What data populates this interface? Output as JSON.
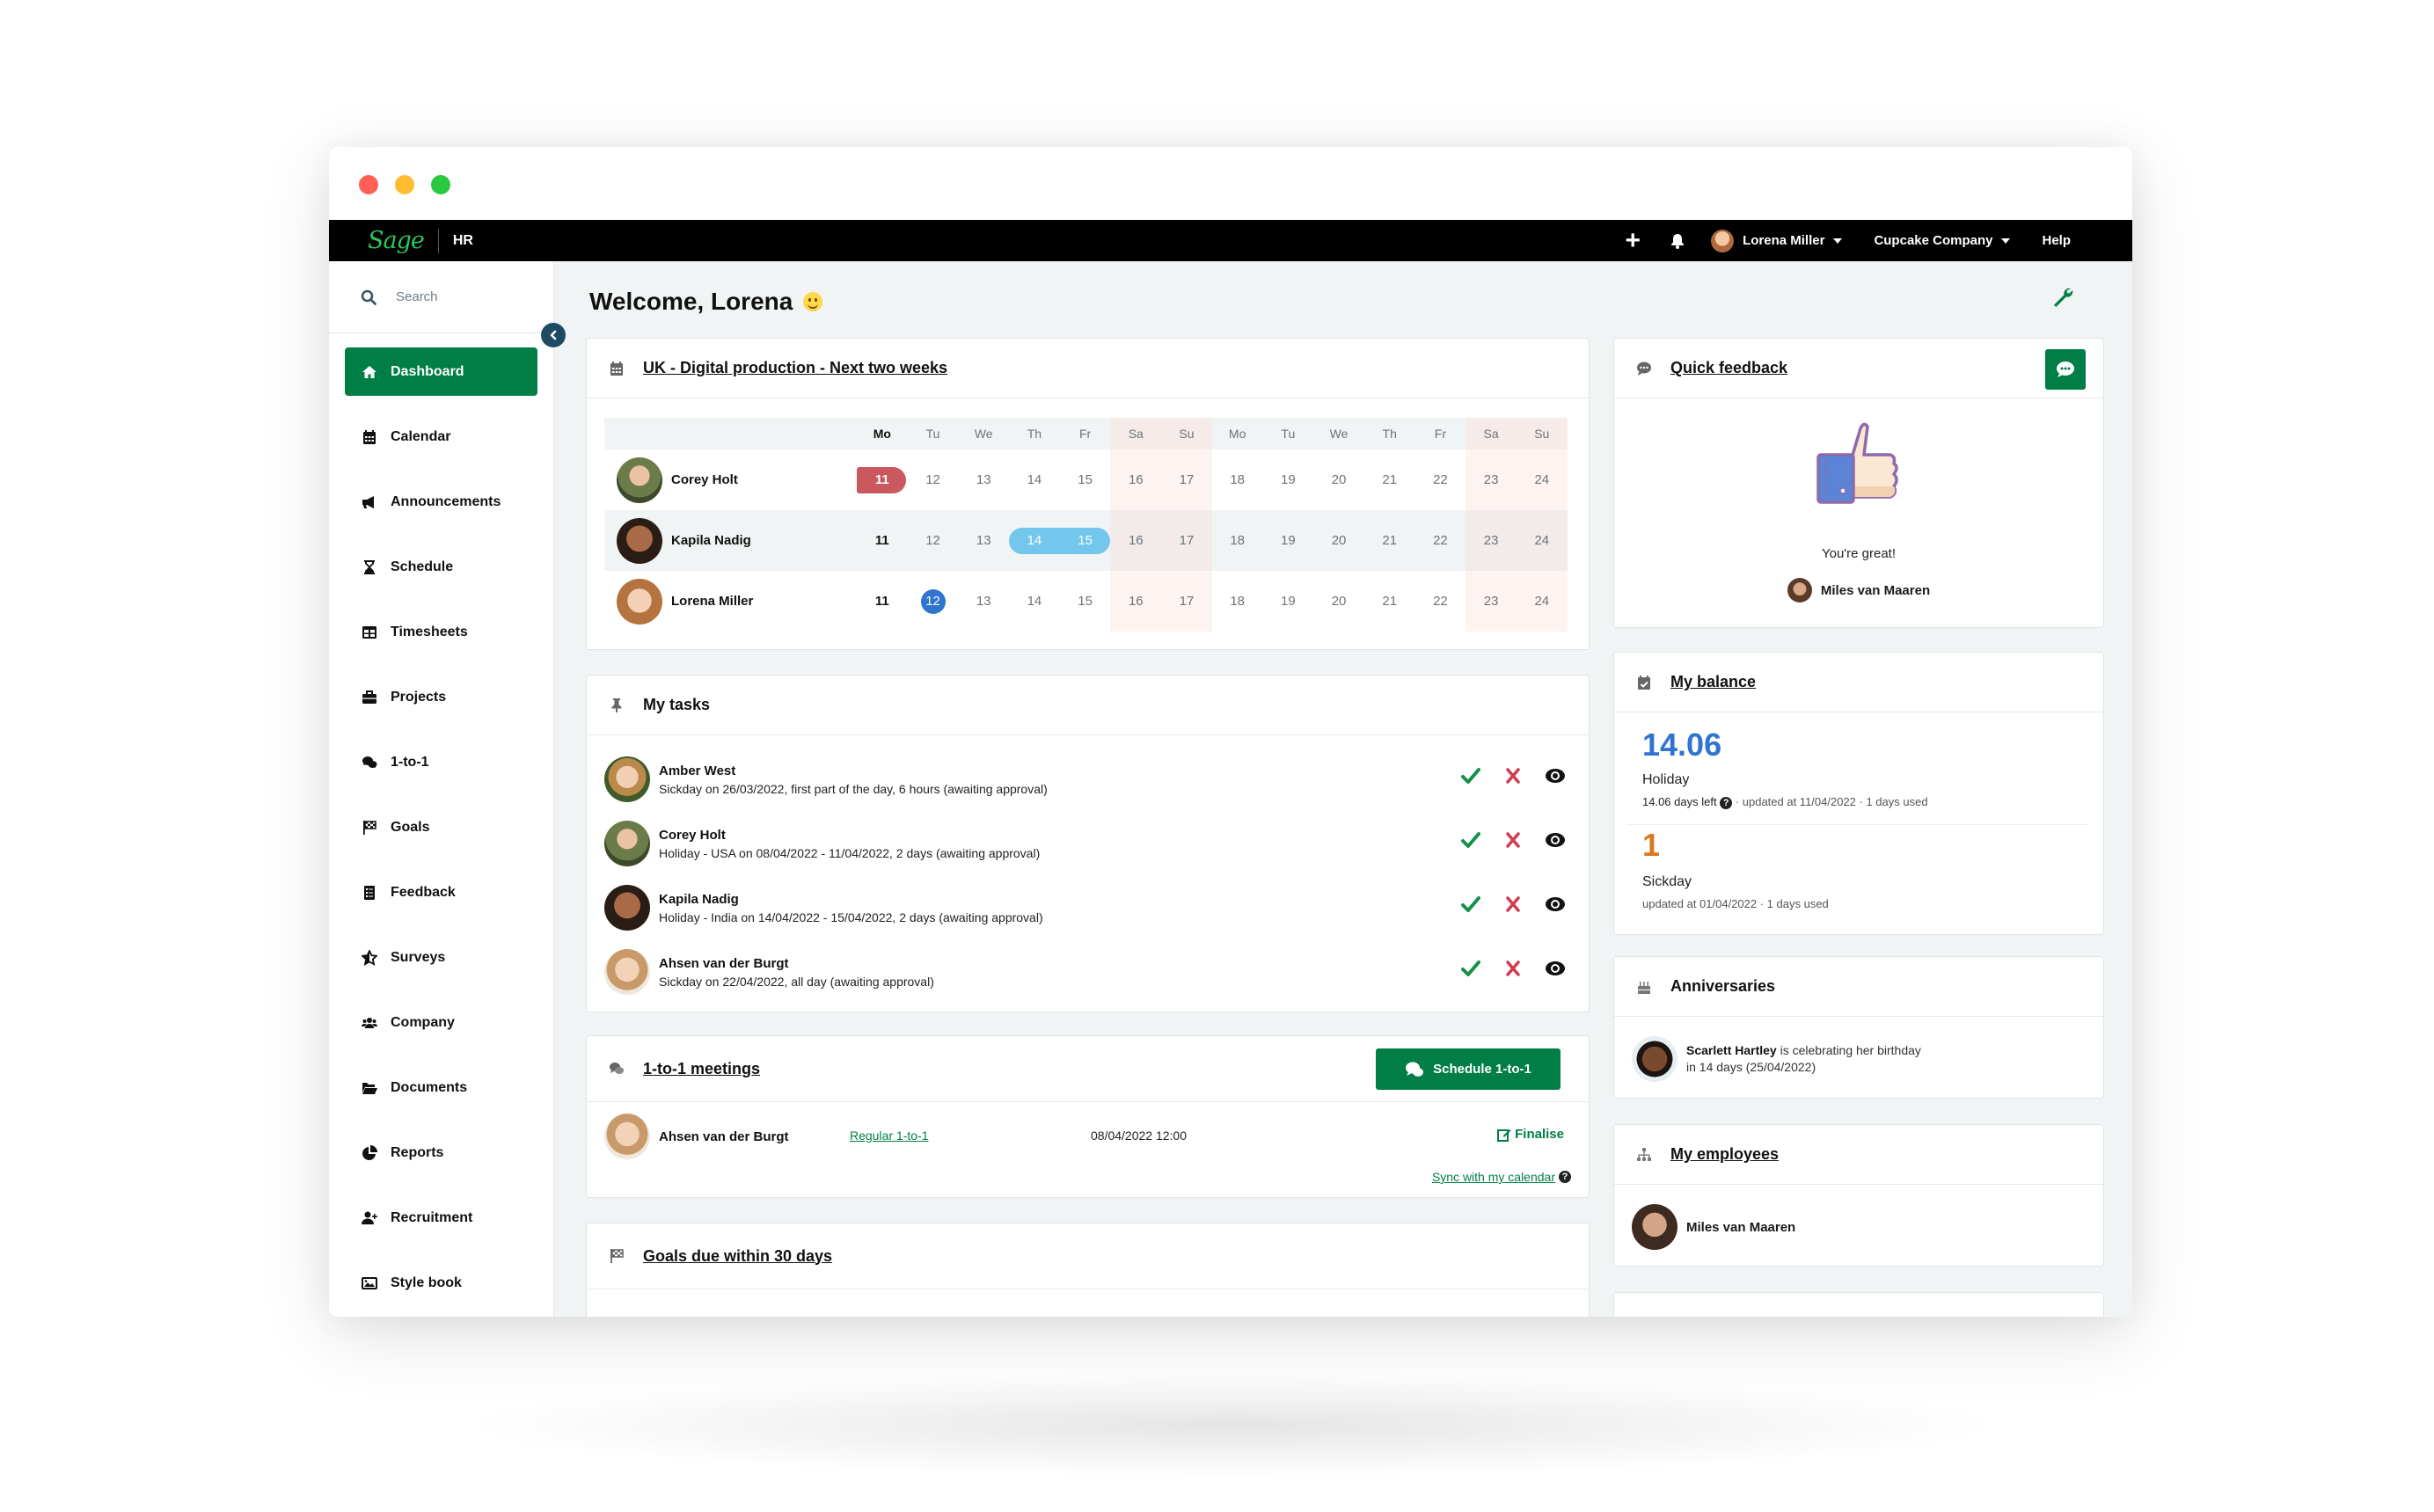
{
  "window": {
    "controls": [
      "close",
      "minimize",
      "maximize"
    ]
  },
  "topnav": {
    "logo": "Sage",
    "product": "HR",
    "add_icon": "plus-icon",
    "notifications_icon": "bell-icon",
    "user_name": "Lorena Miller",
    "company": "Cupcake Company",
    "help": "Help"
  },
  "sidebar": {
    "search_placeholder": "Search",
    "items": [
      {
        "label": "Dashboard",
        "icon": "home-icon",
        "active": true
      },
      {
        "label": "Calendar",
        "icon": "calendar-icon"
      },
      {
        "label": "Announcements",
        "icon": "megaphone-icon"
      },
      {
        "label": "Schedule",
        "icon": "hourglass-icon"
      },
      {
        "label": "Timesheets",
        "icon": "table-icon"
      },
      {
        "label": "Projects",
        "icon": "briefcase-icon"
      },
      {
        "label": "1-to-1",
        "icon": "comments-icon"
      },
      {
        "label": "Goals",
        "icon": "flag-checkered-icon"
      },
      {
        "label": "Feedback",
        "icon": "list-icon"
      },
      {
        "label": "Surveys",
        "icon": "star-icon"
      },
      {
        "label": "Company",
        "icon": "users-icon"
      },
      {
        "label": "Documents",
        "icon": "folder-open-icon"
      },
      {
        "label": "Reports",
        "icon": "pie-chart-icon"
      },
      {
        "label": "Recruitment",
        "icon": "user-plus-icon"
      },
      {
        "label": "Style book",
        "icon": "image-icon"
      }
    ]
  },
  "main": {
    "welcome": "Welcome, Lorena",
    "calendar_card": {
      "title": "UK - Digital production - Next two weeks",
      "weekdays": [
        "Mo",
        "Tu",
        "We",
        "Th",
        "Fr",
        "Sa",
        "Su",
        "Mo",
        "Tu",
        "We",
        "Th",
        "Fr",
        "Sa",
        "Su"
      ],
      "days": [
        "11",
        "12",
        "13",
        "14",
        "15",
        "16",
        "17",
        "18",
        "19",
        "20",
        "21",
        "22",
        "23",
        "24"
      ],
      "people": [
        {
          "name": "Corey Holt",
          "marks": {
            "0": "sick"
          }
        },
        {
          "name": "Kapila Nadig",
          "marks": {
            "3": "holiday",
            "4": "holiday"
          }
        },
        {
          "name": "Lorena Miller",
          "marks": {
            "1": "today"
          }
        }
      ]
    },
    "tasks_card": {
      "title": "My tasks",
      "tasks": [
        {
          "name": "Amber West",
          "desc": "Sickday on 26/03/2022, first part of the day, 6 hours (awaiting approval)"
        },
        {
          "name": "Corey Holt",
          "desc": "Holiday - USA on 08/04/2022 - 11/04/2022, 2 days (awaiting approval)"
        },
        {
          "name": "Kapila Nadig",
          "desc": "Holiday - India on 14/04/2022 - 15/04/2022, 2 days (awaiting approval)"
        },
        {
          "name": "Ahsen van der Burgt",
          "desc": "Sickday on 22/04/2022, all day (awaiting approval)"
        }
      ]
    },
    "meetings_card": {
      "title": "1-to-1 meetings",
      "schedule_button": "Schedule 1-to-1",
      "meeting": {
        "name": "Ahsen van der Burgt",
        "type": "Regular 1-to-1",
        "datetime": "08/04/2022 12:00",
        "action": "Finalise"
      },
      "sync_link": "Sync with my calendar"
    },
    "goals_card": {
      "title": "Goals due within 30 days"
    }
  },
  "right": {
    "feedback_card": {
      "title": "Quick feedback",
      "message": "You're great!",
      "from": "Miles van Maaren"
    },
    "balance_card": {
      "title": "My balance",
      "holiday": {
        "value": "14.06",
        "label": "Holiday",
        "days_left": "14.06 days left",
        "meta": "· updated at 11/04/2022 · 1 days used",
        "color": "#2f74cf"
      },
      "sickday": {
        "value": "1",
        "label": "Sickday",
        "meta": "updated at 01/04/2022 · 1 days used",
        "color": "#d9791f"
      }
    },
    "anniversaries_card": {
      "title": "Anniversaries",
      "person": "Scarlett Hartley",
      "text": "is celebrating her birthday",
      "when": "in 14 days (25/04/2022)"
    },
    "employees_card": {
      "title": "My employees",
      "employee": "Miles van Maaren"
    }
  },
  "colors": {
    "brand_green": "#007e45",
    "sick": "#c9595f",
    "holiday": "#73c7ec",
    "today": "#2f74cf"
  }
}
